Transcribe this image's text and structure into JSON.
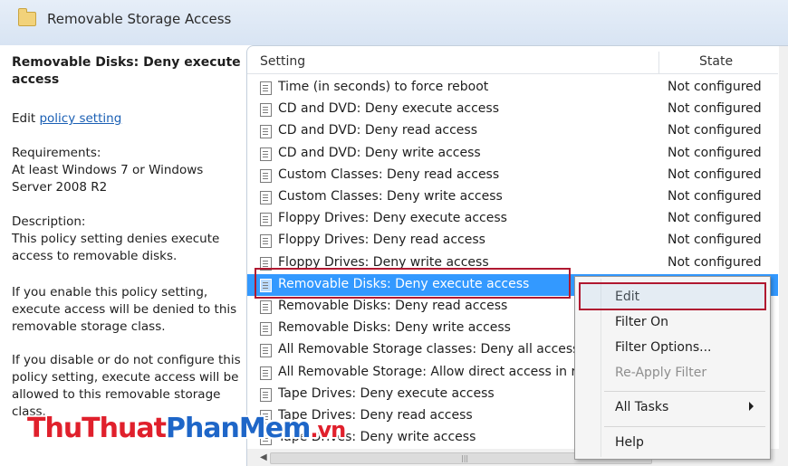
{
  "window": {
    "title": "Removable Storage Access"
  },
  "left_pane": {
    "policy_title": "Removable Disks: Deny execute access",
    "edit_prefix": "Edit ",
    "edit_link": "policy setting",
    "requirements": "Requirements:\nAt least Windows 7 or Windows Server 2008 R2",
    "description": "Description:\nThis policy setting denies execute access to removable disks.",
    "paragraph1": "If you enable this policy setting, execute access will be denied to this removable storage class.",
    "paragraph2": "If you disable or do not configure this policy setting, execute access will be allowed to this removable storage class."
  },
  "list": {
    "columns": {
      "setting": "Setting",
      "state": "State"
    },
    "rows": [
      {
        "name": "Time (in seconds) to force reboot",
        "state": "Not configured"
      },
      {
        "name": "CD and DVD: Deny execute access",
        "state": "Not configured"
      },
      {
        "name": "CD and DVD: Deny read access",
        "state": "Not configured"
      },
      {
        "name": "CD and DVD: Deny write access",
        "state": "Not configured"
      },
      {
        "name": "Custom Classes: Deny read access",
        "state": "Not configured"
      },
      {
        "name": "Custom Classes: Deny write access",
        "state": "Not configured"
      },
      {
        "name": "Floppy Drives: Deny execute access",
        "state": "Not configured"
      },
      {
        "name": "Floppy Drives: Deny read access",
        "state": "Not configured"
      },
      {
        "name": "Floppy Drives: Deny write access",
        "state": "Not configured"
      },
      {
        "name": "Removable Disks: Deny execute access",
        "state": "Not configured",
        "selected": true
      },
      {
        "name": "Removable Disks: Deny read access",
        "state": ""
      },
      {
        "name": "Removable Disks: Deny write access",
        "state": ""
      },
      {
        "name": "All Removable Storage classes: Deny all access",
        "state": ""
      },
      {
        "name": "All Removable Storage: Allow direct access in remote sessions",
        "state": ""
      },
      {
        "name": "Tape Drives: Deny execute access",
        "state": ""
      },
      {
        "name": "Tape Drives: Deny read access",
        "state": ""
      },
      {
        "name": "Tape Drives: Deny write access",
        "state": ""
      }
    ]
  },
  "context_menu": {
    "edit": "Edit",
    "filter_on": "Filter On",
    "filter_options": "Filter Options...",
    "reapply_filter": "Re-Apply Filter",
    "all_tasks": "All Tasks",
    "help": "Help"
  },
  "watermark": {
    "part1": "ThuThuat",
    "part2": "PhanMem",
    "part3": ".vn"
  },
  "colors": {
    "selection": "#3399ff",
    "highlight_box": "#b01830",
    "link": "#1a5fb4"
  },
  "icons": {
    "folder": "folder-icon",
    "policy": "policy-setting-icon",
    "submenu": "submenu-arrow-icon"
  }
}
